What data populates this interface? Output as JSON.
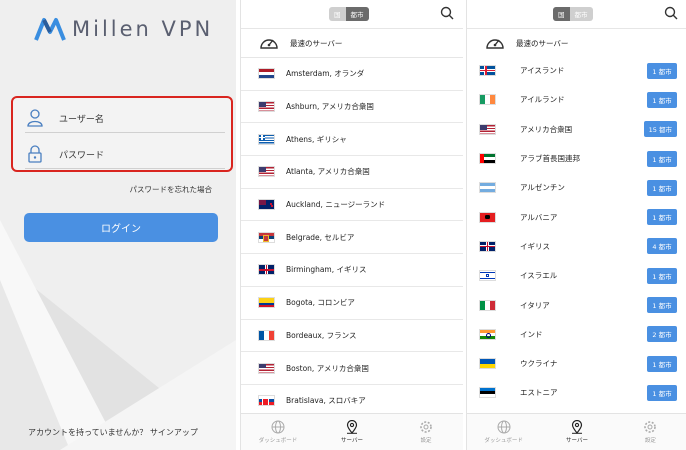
{
  "login": {
    "app_name": "Millen VPN",
    "username_label": "ユーザー名",
    "password_label": "パスワード",
    "forgot_label": "パスワードを忘れた場合",
    "login_button": "ログイン",
    "signup_text": "アカウントを持っていませんか？ サインアップ",
    "brand_color": "#4a90e2",
    "highlight_color": "#d9251f"
  },
  "servers": {
    "seg_country": "国",
    "seg_city": "都市",
    "active_seg": "city",
    "fastest_label": "最速のサーバー",
    "items": [
      {
        "name": "Amsterdam, オランダ",
        "flag": "nl"
      },
      {
        "name": "Ashburn, アメリカ合衆国",
        "flag": "us"
      },
      {
        "name": "Athens, ギリシャ",
        "flag": "gr"
      },
      {
        "name": "Atlanta, アメリカ合衆国",
        "flag": "us"
      },
      {
        "name": "Auckland, ニュージーランド",
        "flag": "nz"
      },
      {
        "name": "Belgrade, セルビア",
        "flag": "rs"
      },
      {
        "name": "Birmingham, イギリス",
        "flag": "gb"
      },
      {
        "name": "Bogota, コロンビア",
        "flag": "co"
      },
      {
        "name": "Bordeaux, フランス",
        "flag": "fr"
      },
      {
        "name": "Boston, アメリカ合衆国",
        "flag": "us"
      },
      {
        "name": "Bratislava, スロバキア",
        "flag": "sk"
      }
    ]
  },
  "countries": {
    "seg_country": "国",
    "seg_city": "都市",
    "active_seg": "country",
    "fastest_label": "最速のサーバー",
    "items": [
      {
        "name": "アイスランド",
        "flag": "is",
        "count": "1 都市"
      },
      {
        "name": "アイルランド",
        "flag": "ie",
        "count": "1 都市"
      },
      {
        "name": "アメリカ合衆国",
        "flag": "us",
        "count": "15 都市"
      },
      {
        "name": "アラブ首長国連邦",
        "flag": "ae",
        "count": "1 都市"
      },
      {
        "name": "アルゼンチン",
        "flag": "ar",
        "count": "1 都市"
      },
      {
        "name": "アルバニア",
        "flag": "al",
        "count": "1 都市"
      },
      {
        "name": "イギリス",
        "flag": "gb",
        "count": "4 都市"
      },
      {
        "name": "イスラエル",
        "flag": "il",
        "count": "1 都市"
      },
      {
        "name": "イタリア",
        "flag": "it",
        "count": "1 都市"
      },
      {
        "name": "インド",
        "flag": "in",
        "count": "2 都市"
      },
      {
        "name": "ウクライナ",
        "flag": "ua",
        "count": "1 都市"
      },
      {
        "name": "エストニア",
        "flag": "ee",
        "count": "1 都市"
      }
    ]
  },
  "tabs": [
    {
      "label": "ダッシュボード",
      "icon": "globe-icon"
    },
    {
      "label": "サーバー",
      "icon": "location-pin-icon"
    },
    {
      "label": "設定",
      "icon": "gear-icon"
    }
  ]
}
